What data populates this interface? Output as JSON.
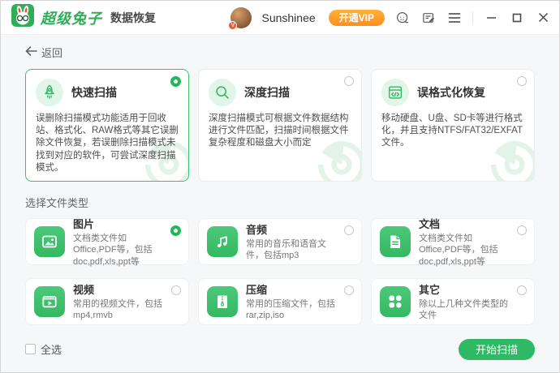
{
  "titlebar": {
    "app_name": "超级兔子",
    "app_subtitle": "数据恢复",
    "username": "Sunshinee",
    "avatar_badge": "V",
    "vip_label": "开通VIP",
    "icons": [
      "rabbit-logo-icon",
      "support-headset-icon",
      "feedback-icon",
      "menu-icon",
      "minimize-icon",
      "maximize-icon",
      "close-icon"
    ]
  },
  "nav": {
    "back_label": "返回",
    "back_icon": "arrow-left-icon"
  },
  "scan_modes": {
    "items": [
      {
        "title": "快速扫描",
        "icon": "rocket-icon",
        "selected": true,
        "desc": "误删除扫描模式功能适用于回收站、格式化、RAW格式等其它误删除文件恢复，若误删除扫描模式未找到对应的软件，可尝试深度扫描模式。"
      },
      {
        "title": "深度扫描",
        "icon": "magnifier-icon",
        "selected": false,
        "desc": "深度扫描模式可根据文件数据结构进行文件匹配，扫描时间根据文件复杂程度和磁盘大小而定"
      },
      {
        "title": "误格式化恢复",
        "icon": "format-disk-icon",
        "selected": false,
        "desc": "移动硬盘、U盘、SD卡等进行格式化，并且支持NTFS/FAT32/EXFAT文件。"
      }
    ]
  },
  "file_types": {
    "section_title": "选择文件类型",
    "items": [
      {
        "title": "图片",
        "icon": "image-icon",
        "selected": true,
        "desc": "文档类文件如Office,PDF等，包括doc,pdf,xls,ppt等"
      },
      {
        "title": "音频",
        "icon": "music-icon",
        "selected": false,
        "desc": "常用的音乐和语音文件，包括mp3"
      },
      {
        "title": "文档",
        "icon": "document-icon",
        "selected": false,
        "desc": "文档类文件如Office,PDF等，包括doc,pdf,xls,ppt等"
      },
      {
        "title": "视频",
        "icon": "video-icon",
        "selected": false,
        "desc": "常用的视频文件，包括mp4,rmvb"
      },
      {
        "title": "压缩",
        "icon": "zip-icon",
        "selected": false,
        "desc": "常用的压缩文件，包括rar,zip,iso"
      },
      {
        "title": "其它",
        "icon": "other-icon",
        "selected": false,
        "desc": "除以上几种文件类型的文件"
      }
    ]
  },
  "footer": {
    "select_all_label": "全选",
    "select_all_checked": false,
    "start_button_label": "开始扫描"
  },
  "colors": {
    "primary_green": "#2eb964",
    "light_green": "#e1f5e8",
    "vip_orange": "#ff9e27",
    "selected_border": "#3cc173"
  }
}
